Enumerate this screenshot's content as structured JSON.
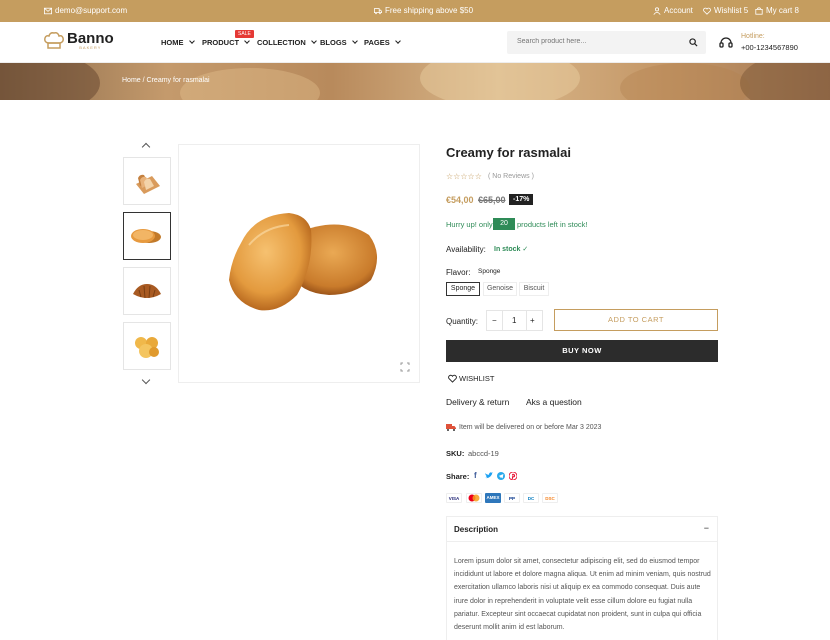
{
  "topbar": {
    "email": "demo@support.com",
    "shipping": "Free shipping above $50",
    "account": "Account",
    "wishlist": "Wishlist 5",
    "cart": "My cart 8"
  },
  "header": {
    "logo_name": "Banno",
    "logo_sub": "BAKERY",
    "nav": [
      "HOME",
      "PRODUCT",
      "COLLECTION",
      "BLOGS",
      "PAGES"
    ],
    "sale_badge": "SALE",
    "search_placeholder": "Search product here...",
    "hotline_label": "Hotline:",
    "hotline_number": "+00-1234567890"
  },
  "breadcrumb": {
    "home": "Home",
    "separator": "/",
    "current": "Creamy for rasmalai"
  },
  "product": {
    "title": "Creamy for rasmalai",
    "rating_stars": 0,
    "reviews": "( No Reviews )",
    "price": "€54,00",
    "old_price": "€65,00",
    "discount": "-17%",
    "stock_prefix": "Hurry up! only",
    "stock_count": "20",
    "stock_suffix": "products left in stock!",
    "availability_label": "Availability:",
    "availability_value": "In stock",
    "flavor_label": "Flavor:",
    "flavor_selected": "Sponge",
    "flavor_options": [
      "Sponge",
      "Genoise",
      "Biscuit"
    ],
    "quantity_label": "Quantity:",
    "quantity_value": "1",
    "minus": "−",
    "plus": "+",
    "add_to_cart": "ADD TO CART",
    "buy_now": "BUY NOW",
    "wishlist": "WISHLIST",
    "delivery_return": "Delivery & return",
    "ask_question": "Aks a question",
    "delivery_note": "Item will be delivered on or before Mar 3 2023",
    "sku_label": "SKU:",
    "sku_value": "abccd-19",
    "share_label": "Share:",
    "payments": [
      "VISA",
      "MC",
      "AMEX",
      "PP",
      "DC",
      "DSC"
    ],
    "description_title": "Description",
    "description_toggle": "−",
    "description_text": "Lorem ipsum dolor sit amet, consectetur adipiscing elit, sed do eiusmod tempor incididunt ut labore et dolore magna aliqua. Ut enim ad minim veniam, quis nostrud exercitation ullamco laboris nisi ut aliquip ex ea commodo consequat. Duis aute irure dolor in reprehenderit in voluptate velit esse cillum dolore eu fugiat nulla pariatur. Excepteur sint occaecat cupidatat non proident, sunt in culpa qui officia deserunt mollit anim id est laborum."
  },
  "colors": {
    "accent": "#c59d5f",
    "dark": "#2c2c2c",
    "green": "#2e8b57"
  }
}
